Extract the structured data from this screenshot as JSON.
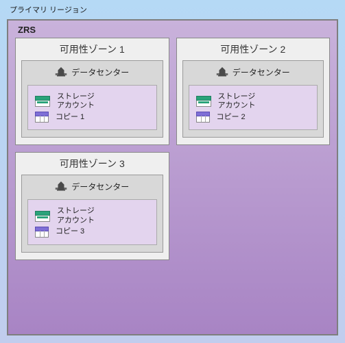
{
  "region_label": "プライマリ リージョン",
  "zrs_label": "ZRS",
  "zones": [
    {
      "title": "可用性ゾーン 1",
      "datacenter_label": "データセンター",
      "storage_label_line1": "ストレージ",
      "storage_label_line2": "アカウント",
      "copy_label": "コピー 1"
    },
    {
      "title": "可用性ゾーン 2",
      "datacenter_label": "データセンター",
      "storage_label_line1": "ストレージ",
      "storage_label_line2": "アカウント",
      "copy_label": "コピー 2"
    },
    {
      "title": "可用性ゾーン 3",
      "datacenter_label": "データセンター",
      "storage_label_line1": "ストレージ",
      "storage_label_line2": "アカウント",
      "copy_label": "コピー 3"
    }
  ],
  "colors": {
    "region_bg_top": "#b5d9f5",
    "region_bg_bottom": "#c1cdee",
    "zrs_bg_top": "#c9b2db",
    "zrs_bg_bottom": "#a884c4",
    "zone_bg": "#efefef",
    "dc_bg": "#d8d8d8",
    "storage_bg": "#e3d4ee",
    "storage_accent": "#2aa37a",
    "copy_accent": "#7f6fd6"
  }
}
